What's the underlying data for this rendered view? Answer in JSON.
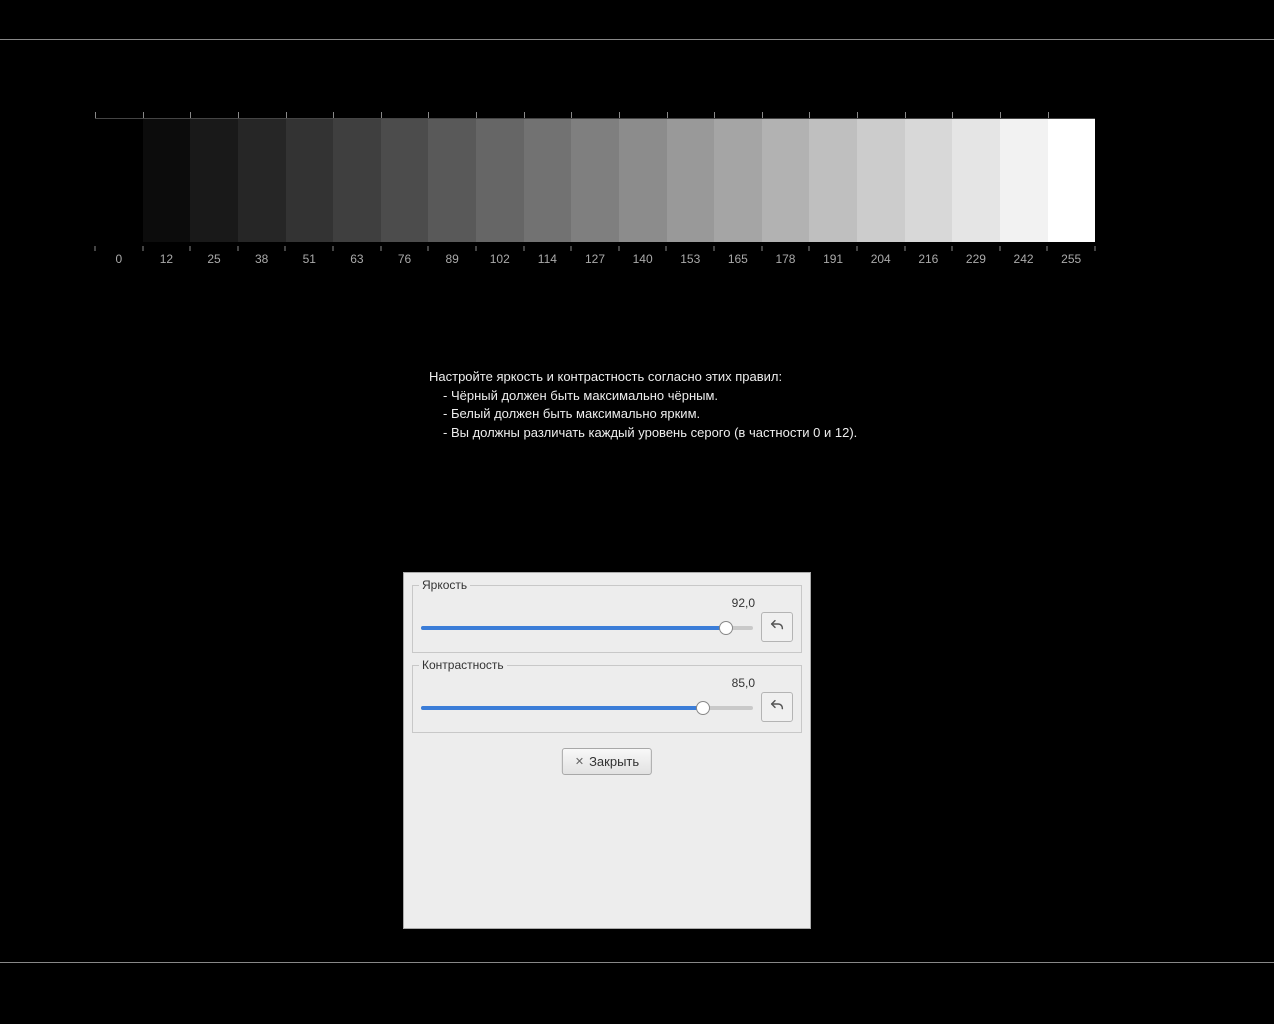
{
  "grayscale": {
    "levels": [
      0,
      12,
      25,
      38,
      51,
      63,
      76,
      89,
      102,
      114,
      127,
      140,
      153,
      165,
      178,
      191,
      204,
      216,
      229,
      242,
      255
    ]
  },
  "instructions": {
    "title": "Настройте яркость и контрастность согласно этих правил:",
    "rules": [
      "- Чёрный должен быть максимально чёрным.",
      "- Белый должен быть максимально ярким.",
      "- Вы должны различать каждый уровень серого (в частности 0 и 12)."
    ]
  },
  "dialog": {
    "brightness": {
      "label": "Яркость",
      "value": "92,0",
      "percent": 92
    },
    "contrast": {
      "label": "Контрастность",
      "value": "85,0",
      "percent": 85
    },
    "close_label": "Закрыть"
  }
}
